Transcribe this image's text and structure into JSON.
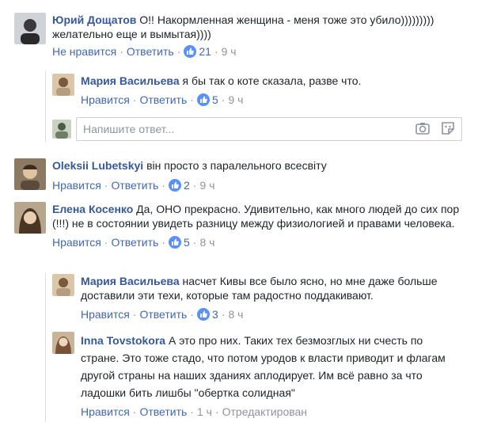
{
  "comments": [
    {
      "author": "Юрий Дощатов",
      "text": "О!! Накормленная женщина - меня тоже это убило))))))))) желательно еще и вымытая))))",
      "like_label": "Не нравится",
      "reply_label": "Ответить",
      "likes": "21",
      "time": "9 ч",
      "replies": [
        {
          "author": "Мария Васильева",
          "text": "я бы так о коте сказала, разве что.",
          "like_label": "Нравится",
          "reply_label": "Ответить",
          "likes": "5",
          "time": "9 ч"
        }
      ],
      "reply_input": {
        "placeholder": "Напишите ответ..."
      }
    },
    {
      "author": "Oleksii Lubetskyi",
      "text": "він просто з паралельного всесвіту",
      "like_label": "Нравится",
      "reply_label": "Ответить",
      "likes": "2",
      "time": "9 ч"
    },
    {
      "author": "Елена Косенко",
      "text": "Да, ОНО прекрасно. Удивительно, как много людей до сих пор (!!!) не в состоянии увидеть разницу между физиологией и правами человека.",
      "like_label": "Нравится",
      "reply_label": "Ответить",
      "likes": "5",
      "time": "8 ч",
      "replies": [
        {
          "author": "Мария Васильева",
          "text": "насчет Кивы все было ясно, но мне даже больше доставили эти техи, которые там радостно поддакивают.",
          "like_label": "Нравится",
          "reply_label": "Ответить",
          "likes": "3",
          "time": "8 ч"
        },
        {
          "author": "Inna Tovstokora",
          "text": "А это про них. Таких тех безмозглых ни счесть по стране. Это тоже стадо, что потом уродов к власти приводит и флагам другой страны на наших зданиях аплодирует. Им всё равно за что ладошки бить лишбы \"обертка солидная\"",
          "like_label": "Нравится",
          "reply_label": "Ответить",
          "time": "1 ч",
          "edited": "Отредактирован"
        }
      ]
    }
  ],
  "colors": {
    "link": "#4267b2",
    "author": "#365899",
    "meta": "#90949c",
    "like_badge": "#5890ff"
  },
  "icons": {
    "like": "thumbs-up-icon",
    "camera": "camera-icon",
    "sticker": "sticker-icon"
  }
}
